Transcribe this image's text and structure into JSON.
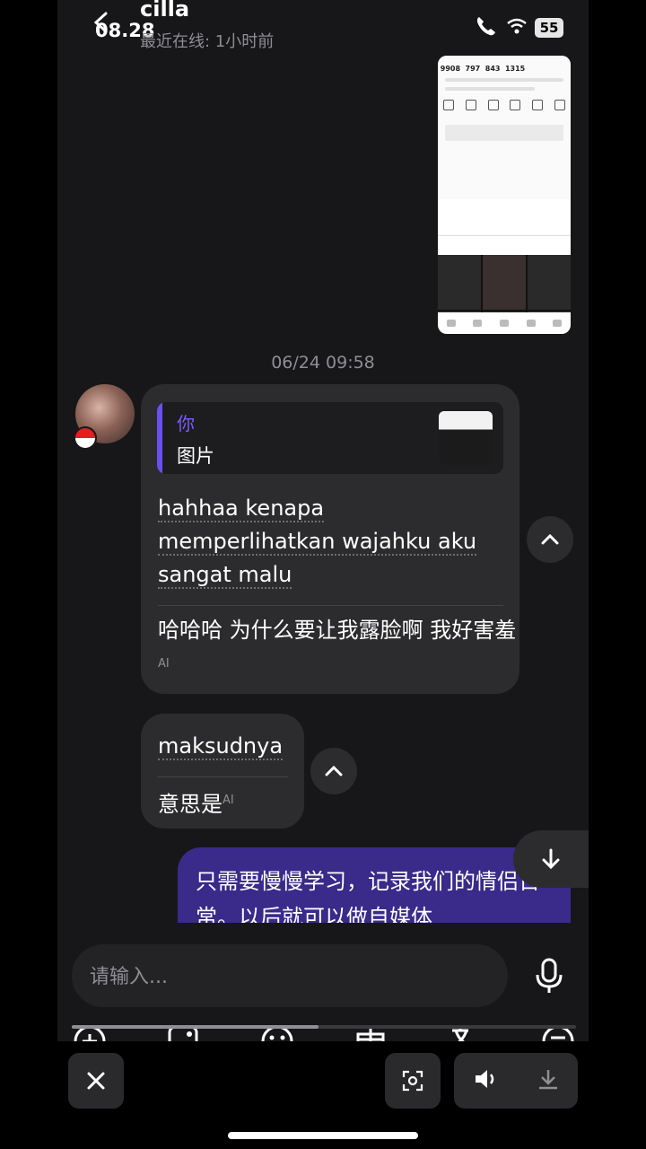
{
  "status_bar": {
    "time": "08.28",
    "battery": "55"
  },
  "header": {
    "name": "cilla",
    "last_seen": "最近在线: 1小时前"
  },
  "shared_image": {
    "stats": [
      "9908",
      "797",
      "843",
      "1315"
    ]
  },
  "date_separator": "06/24 09:58",
  "incoming_1": {
    "quote_author": "你",
    "quote_content": "图片",
    "original_lines": [
      "hahhaa kenapa",
      "memperlihatkan wajahku aku",
      "sangat malu"
    ],
    "translation": "哈哈哈 为什么要让我露脸啊 我好害羞",
    "ai_badge": "AI"
  },
  "incoming_2": {
    "original": "maksudnya",
    "translation": "意思是",
    "ai_badge": "AI"
  },
  "outgoing_1": {
    "text": "只需要慢慢学习，记录我们的情侣日常。以后就可以做自媒体"
  },
  "composer": {
    "placeholder": "请输入..."
  },
  "toolbar": {
    "scroll_progress": 0.49
  },
  "colors": {
    "accent": "#6c4ef2",
    "outgoing_bubble": "#3a2a8a",
    "incoming_bubble": "#2c2c2e",
    "background": "#17171a"
  }
}
